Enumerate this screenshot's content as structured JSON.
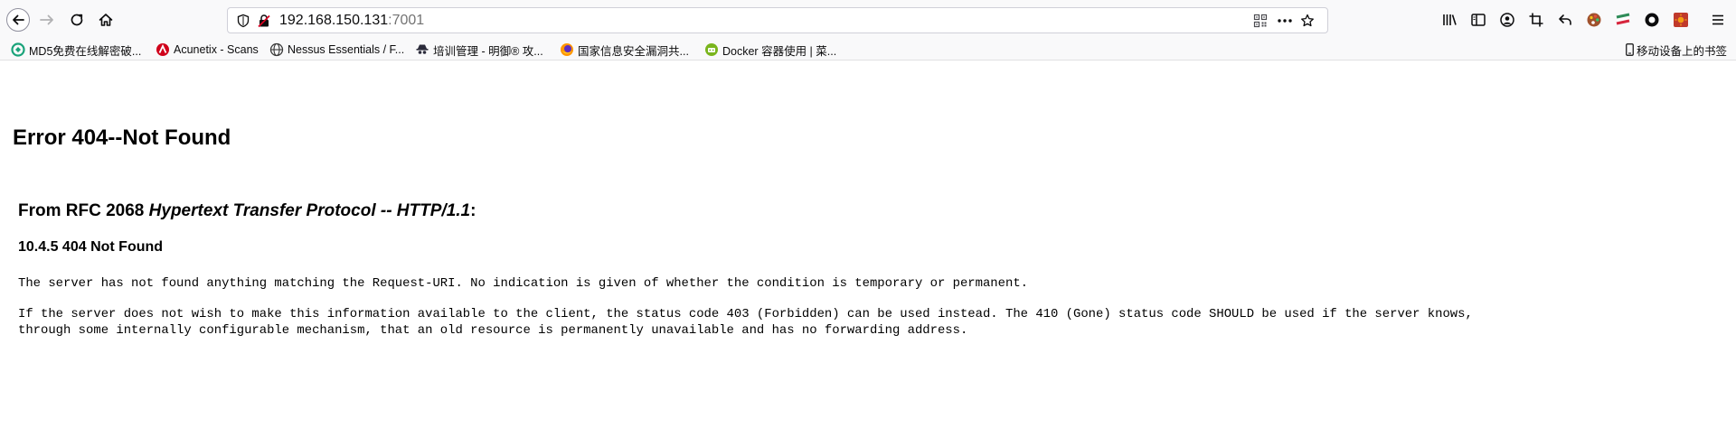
{
  "toolbar": {
    "url_host": "192.168.150.131",
    "url_port": ":7001"
  },
  "bookmarks": [
    {
      "label": "MD5免费在线解密破...",
      "icon": "md5-site-icon",
      "color": "#1aa37a"
    },
    {
      "label": "Acunetix - Scans",
      "icon": "acunetix-icon",
      "color": "#d0021b"
    },
    {
      "label": "Nessus Essentials / F...",
      "icon": "globe-icon",
      "color": "#3a3a3a"
    },
    {
      "label": "培训管理 - 明御® 攻...",
      "icon": "spy-icon",
      "color": "#2a2a3a"
    },
    {
      "label": "国家信息安全漏洞共...",
      "icon": "firefox-icon",
      "color": "#ff9500"
    },
    {
      "label": "Docker 容器使用 | 菜...",
      "icon": "runoob-icon",
      "color": "#7ab51d"
    }
  ],
  "mobile_bookmarks": "移动设备上的书签",
  "page": {
    "title": "Error 404--Not Found",
    "rfc_prefix": "From RFC 2068 ",
    "rfc_italic": "Hypertext Transfer Protocol -- HTTP/1.1",
    "rfc_suffix": ":",
    "section": "10.4.5 404 Not Found",
    "para1": "The server has not found anything matching the Request-URI. No indication is given of whether the condition is temporary or permanent.",
    "para2_line1": "If the server does not wish to make this information available to the client, the status code 403 (Forbidden) can be used instead. The 410 (Gone) status code SHOULD be used if the server knows,",
    "para2_line2": "through some internally configurable mechanism, that an old resource is permanently unavailable and has no forwarding address."
  }
}
